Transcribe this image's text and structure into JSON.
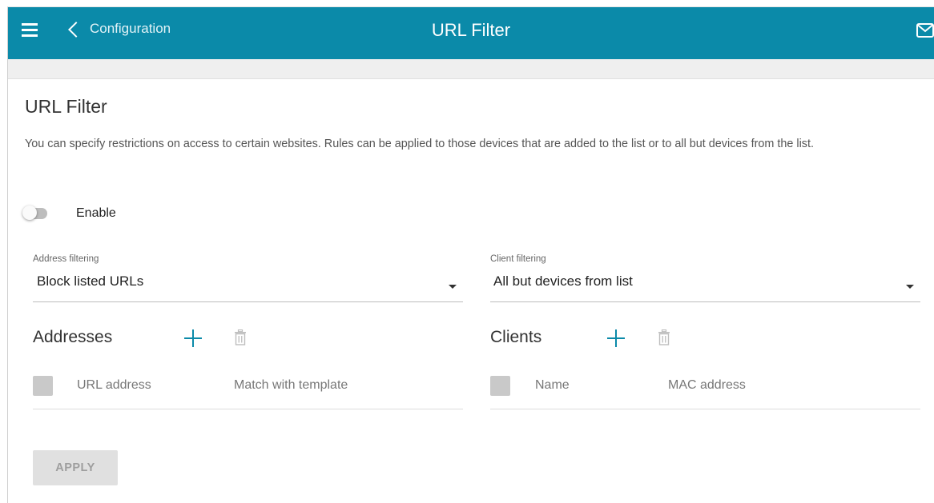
{
  "header": {
    "back_label": "Configuration",
    "title": "URL Filter",
    "brand_color": "#0b8aa9"
  },
  "page": {
    "heading": "URL Filter",
    "description": "You can specify restrictions on access to certain websites. Rules can be applied to those devices that are added to the list or to all but devices from the list."
  },
  "enable": {
    "label": "Enable",
    "checked": false
  },
  "address_filtering": {
    "label": "Address filtering",
    "value": "Block listed URLs"
  },
  "client_filtering": {
    "label": "Client filtering",
    "value": "All but devices from list"
  },
  "addresses": {
    "title": "Addresses",
    "columns": [
      "URL address",
      "Match with template"
    ]
  },
  "clients": {
    "title": "Clients",
    "columns": [
      "Name",
      "MAC address"
    ]
  },
  "apply_label": "APPLY",
  "icons": [
    "menu-icon",
    "chevron-left-icon",
    "mail-icon",
    "plus-icon",
    "trash-icon"
  ]
}
